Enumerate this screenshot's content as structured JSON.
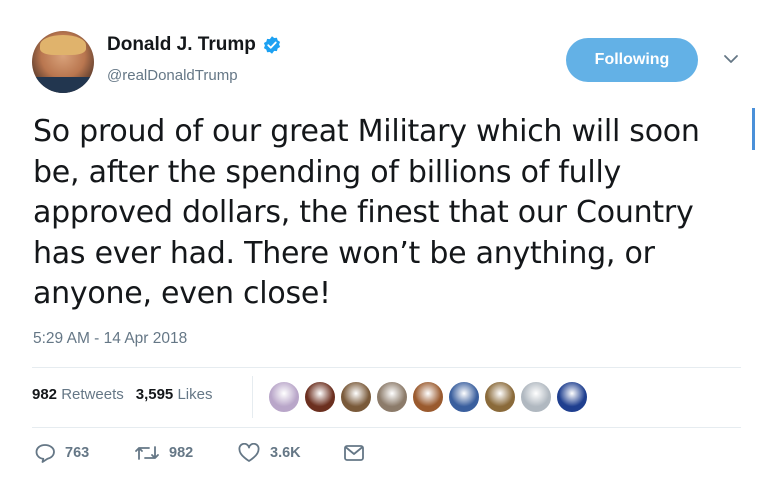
{
  "user": {
    "name": "Donald J. Trump",
    "handle": "@realDonaldTrump",
    "verified_color": "#1da1f2"
  },
  "follow_button": {
    "label": "Following",
    "color": "#63b1e6"
  },
  "tweet": {
    "lines": [
      "So proud of our great Military which will soon",
      "be, after the spending of billions of fully",
      "approved dollars, the finest that our Country",
      "has ever had. There won’t be anything, or",
      "anyone, even close!"
    ],
    "timestamp": "5:29 AM - 14 Apr 2018"
  },
  "stats": {
    "retweets_count": "982",
    "retweets_label": "Retweets",
    "likes_count": "3,595",
    "likes_label": "Likes"
  },
  "likers": [
    {
      "color": "#b9a6c9"
    },
    {
      "color": "#6b2f1f"
    },
    {
      "color": "#7a5a3a"
    },
    {
      "color": "#8c7b6a"
    },
    {
      "color": "#9a5a2e"
    },
    {
      "color": "#3a5f9e"
    },
    {
      "color": "#8a6a3a"
    },
    {
      "color": "#b0b8c0"
    },
    {
      "color": "#1f3f8f"
    }
  ],
  "actions": {
    "reply_count": "763",
    "retweet_count": "982",
    "like_count": "3.6K"
  },
  "icons": [
    "verified-badge-icon",
    "chevron-down-icon",
    "reply-icon",
    "retweet-icon",
    "like-icon",
    "direct-message-icon"
  ]
}
